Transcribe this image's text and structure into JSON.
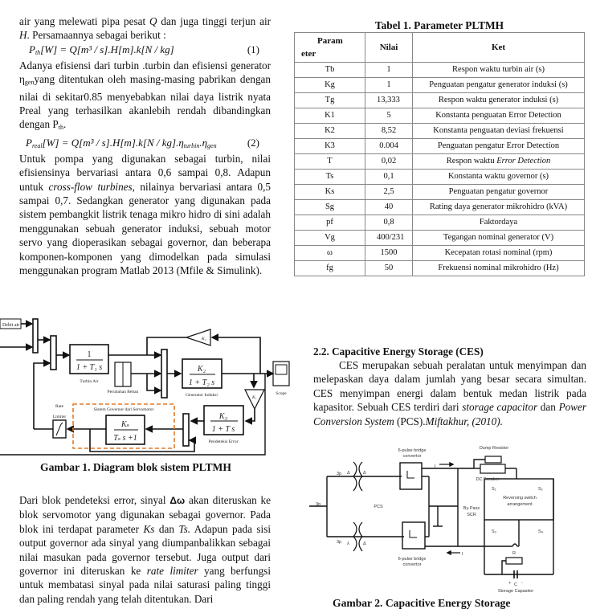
{
  "left_column": {
    "intro": {
      "line1_pre": "air yang melewati pipa pesat ",
      "Q": "Q",
      "line1_post": " dan juga tinggi terjun air ",
      "H": "H",
      "line1_end": ". Persamaannya sebagai berikut :"
    },
    "equation1": {
      "text": "P",
      "sub": "th",
      "rest": "[W] = Q[m³ / s].H[m].k[N / kg]",
      "number": "(1)"
    },
    "para_efficiency": {
      "a": "Adanya efisiensi dari turbin .turbin dan efisiensi generator η",
      "sub_gen": "gen",
      "b": "yang ditentukan oleh masing-masing pabrikan dengan nilai di sekitar0.85 menyebabkan nilai daya listrik nyata Preal yang terhasilkan akanlebih rendah dibandingkan dengan P",
      "sub_th": "th",
      "c": "."
    },
    "equation2": {
      "text": "P",
      "sub": "real",
      "rest": "[W] = Q[m³ / s].H[m].k[N / kg].η",
      "sub_turbin": "turbin",
      "eta": ".η",
      "sub_gen": "gen",
      "number": "(2)"
    },
    "para_pump": {
      "a": "Untuk pompa yang digunakan sebagai turbin, nilai efisiensinya bervariasi antara 0,6 sampai 0,8. Adapun untuk ",
      "italic": "cross-flow turbines,",
      "b": " nilainya bervariasi antara 0,5 sampai 0,7. Sedangkan generator yang digunakan pada sistem pembangkit listrik tenaga mikro hidro di sini adalah menggunakan sebuah generator induksi, sebuah motor servo yang dioperasikan sebagai governor, dan beberapa komponen-komponen yang dimodelkan pada simulasi menggunakan program Matlab 2013 (Mfile & Simulink)."
    },
    "figure1": {
      "caption": "Gambar 1. Diagram blok sistem PLTMH",
      "labels": {
        "debit_air": "Debit air",
        "turbin_num": "1",
        "turbin_den": "1 + T₁ s",
        "turbin_air": "Turbin Air",
        "perubahan_beban": "Perubahan Beban",
        "gen_num": "K₂",
        "gen_den": "1 + T₂ s",
        "generator_induksi": "Generator Induksi",
        "scope": "Scope",
        "k2_gain": "K₂",
        "k1_gain": "K₁",
        "err_num": "K₃",
        "err_den": "1 + T s",
        "pendeteksi_error": "Pendeteksi Error",
        "gov_num": "Kₛ",
        "gov_den": "Tₛ s +1",
        "governor_group": "Sistem Governor dari Servomotor",
        "rate": "Rate",
        "limiter": "Limiter"
      },
      "accent_color": "#e07a2a"
    },
    "para_error": {
      "a": "Dari blok pendeteksi error, sinyal ",
      "symbol": "Δω",
      "b": " akan diteruskan ke blok servomotor yang digunakan sebagai governor. Pada blok ini terdapat parameter ",
      "ks": "Ks",
      "c": " dan ",
      "ts": "Ts.",
      "d": " Adapun pada sisi output governor ada sinyal yang diumpanbalikkan sebagai nilai masukan pada governor tersebut. Juga output dari governor ini diteruskan ke ",
      "rl": "rate limiter",
      "e": " yang berfungsi untuk membatasi sinyal pada nilai saturasi paling tinggi dan paling rendah yang telah ditentukan. Dari"
    }
  },
  "table1": {
    "title": "Tabel 1. Parameter PLTMH",
    "headers": {
      "param_1": "Param",
      "param_2": "eter",
      "nilai": "Nilai",
      "ket": "Ket"
    },
    "rows": [
      {
        "param": "Tb",
        "nilai": "1",
        "ket": "Respon waktu turbin air (s)"
      },
      {
        "param": "Kg",
        "nilai": "1",
        "ket": "Penguatan pengatur generator induksi (s)"
      },
      {
        "param": "Tg",
        "nilai": "13,333",
        "ket": "Respon waktu generator induksi (s)"
      },
      {
        "param": "K1",
        "nilai": "5",
        "ket": "Konstanta penguatan Error Detection"
      },
      {
        "param": "K2",
        "nilai": "8,52",
        "ket": "Konstanta penguatan deviasi frekuensi"
      },
      {
        "param": "K3",
        "nilai": "0.004",
        "ket": "Penguatan pengatur Error Detection"
      },
      {
        "param": "T",
        "nilai": "0,02",
        "ket_pre": "Respon waktu ",
        "ket_italic": "Error Detection"
      },
      {
        "param": "Ts",
        "nilai": "0,1",
        "ket": "Konstanta waktu governor (s)"
      },
      {
        "param": "Ks",
        "nilai": "2,5",
        "ket": "Penguatan pengatur governor"
      },
      {
        "param": "Sg",
        "nilai": "40",
        "ket": "Rating daya generator mikrohidro (kVA)"
      },
      {
        "param": "pf",
        "nilai": "0,8",
        "ket": "Faktordaya"
      },
      {
        "param": "Vg",
        "nilai": "400/231",
        "ket": "Tegangan nominal generator (V)"
      },
      {
        "param": "ω",
        "nilai": "1500",
        "ket": "Kecepatan rotasi nominal (rpm)"
      },
      {
        "param": "fg",
        "nilai": "50",
        "ket": "Frekuensi nominal mikrohidro (Hz)"
      }
    ]
  },
  "right_column": {
    "section_title": "2.2. Capacitive Energy Storage (CES)",
    "para_ces": {
      "a": "CES merupakan sebuah peralatan untuk menyimpan dan melepaskan daya dalam jumlah yang besar secara simultan. CES menyimpan energi dalam bentuk medan listrik pada kapasitor. Sebuah CES terdiri dari ",
      "i1": "storage capacitor",
      "b": " dan ",
      "i2": "Power Conversion System",
      "c": " (PCS).",
      "i3": "Miftakhur, (2010)."
    },
    "figure2": {
      "caption": "Gambar 2. Capacitive Energy Storage",
      "labels": {
        "bridge_top_1": "6-pulse bridge",
        "bridge_top_2": "convertor",
        "bridge_bot_1": "6-pulse bridge",
        "bridge_bot_2": "convertor",
        "dump_resistor": "Dump Resistor",
        "dc_breaker": "DC Breaker",
        "id_top": "I",
        "id_bot": "I",
        "id_sub": "d",
        "in_3p": "3p",
        "top_3p": "3p",
        "bot_3p": "3p",
        "pcs": "PCS",
        "bypass_1": "By Pass",
        "bypass_2": "SCR",
        "s1": "S₁",
        "s2": "S₂",
        "s3": "S₃",
        "s4": "S₄",
        "reversing_1": "Reversing switch",
        "reversing_2": "arrangement",
        "r": "R",
        "c": "C",
        "plus": "+",
        "minus": "-",
        "storage_cap": "Storage Capasitor",
        "delta": "Δ",
        "lambda": "λ"
      }
    }
  }
}
